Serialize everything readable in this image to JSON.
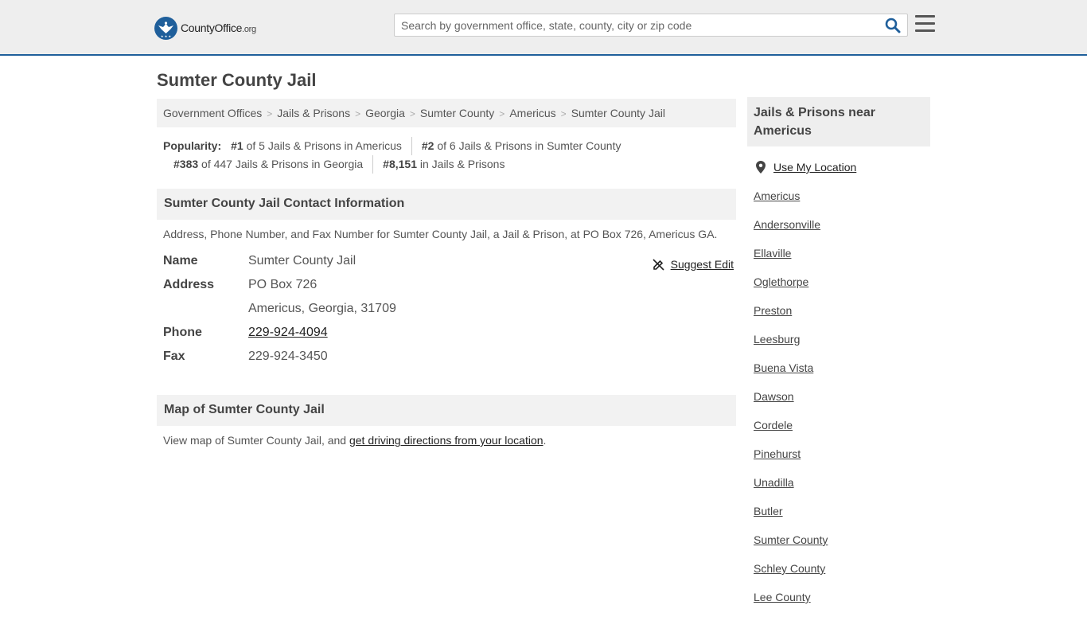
{
  "site": {
    "logo_main": "CountyOffice",
    "logo_tld": ".org",
    "search_placeholder": "Search by government office, state, county, city or zip code"
  },
  "page": {
    "title": "Sumter County Jail"
  },
  "breadcrumb": [
    "Government Offices",
    "Jails & Prisons",
    "Georgia",
    "Sumter County",
    "Americus",
    "Sumter County Jail"
  ],
  "popularity": {
    "label": "Popularity:",
    "items": [
      {
        "rank": "#1",
        "text": "of 5 Jails & Prisons in Americus"
      },
      {
        "rank": "#2",
        "text": "of 6 Jails & Prisons in Sumter County"
      },
      {
        "rank": "#383",
        "text": "of 447 Jails & Prisons in Georgia"
      },
      {
        "rank": "#8,151",
        "text": "in Jails & Prisons"
      }
    ]
  },
  "contact": {
    "heading": "Sumter County Jail Contact Information",
    "description": "Address, Phone Number, and Fax Number for Sumter County Jail, a Jail & Prison, at PO Box 726, Americus GA.",
    "suggest_edit": "Suggest Edit",
    "name_label": "Name",
    "name_value": "Sumter County Jail",
    "address_label": "Address",
    "address_line1": "PO Box 726",
    "address_line2": "Americus, Georgia, 31709",
    "phone_label": "Phone",
    "phone_value": "229-924-4094",
    "fax_label": "Fax",
    "fax_value": "229-924-3450"
  },
  "map": {
    "heading": "Map of Sumter County Jail",
    "text_prefix": "View map of Sumter County Jail, and ",
    "link_text": "get driving directions from your location",
    "text_suffix": "."
  },
  "sidebar": {
    "heading": "Jails & Prisons near Americus",
    "use_location": "Use My Location",
    "links": [
      "Americus",
      "Andersonville",
      "Ellaville",
      "Oglethorpe",
      "Preston",
      "Leesburg",
      "Buena Vista",
      "Dawson",
      "Cordele",
      "Pinehurst",
      "Unadilla",
      "Butler",
      "Sumter County",
      "Schley County",
      "Lee County"
    ]
  },
  "colors": {
    "brand_blue": "#1f5f9b",
    "header_bg": "#eeeeee",
    "section_bg": "#f2f2f2"
  }
}
